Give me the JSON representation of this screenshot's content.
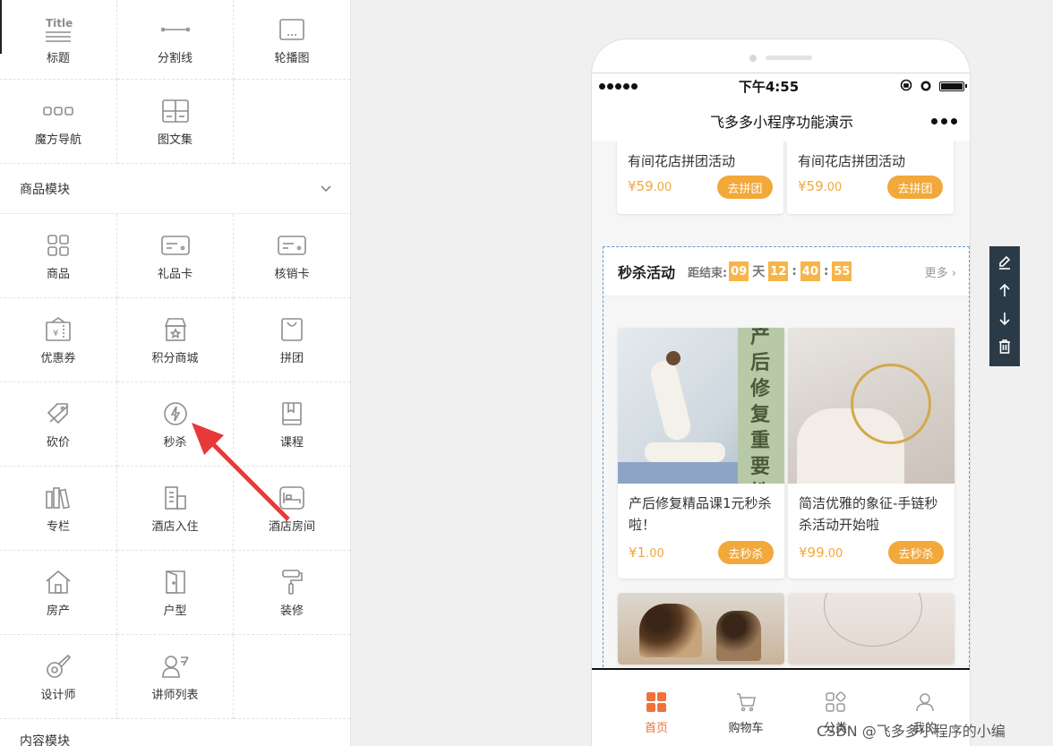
{
  "sidebar": {
    "top_items": [
      {
        "label": "标题",
        "icon": "title-icon",
        "icon_text": "Title"
      },
      {
        "label": "分割线",
        "icon": "divider-icon"
      },
      {
        "label": "轮播图",
        "icon": "carousel-icon"
      },
      {
        "label": "魔方导航",
        "icon": "cube-nav-icon"
      },
      {
        "label": "图文集",
        "icon": "gallery-icon"
      }
    ],
    "section_goods": {
      "title": "商品模块",
      "toggle_icon": "chevron-down-icon"
    },
    "goods_items": [
      {
        "label": "商品",
        "icon": "grid-icon"
      },
      {
        "label": "礼品卡",
        "icon": "gift-card-icon"
      },
      {
        "label": "核销卡",
        "icon": "verify-card-icon"
      },
      {
        "label": "优惠券",
        "icon": "coupon-icon"
      },
      {
        "label": "积分商城",
        "icon": "store-icon"
      },
      {
        "label": "拼团",
        "icon": "bag-icon"
      },
      {
        "label": "砍价",
        "icon": "bargain-tag-icon"
      },
      {
        "label": "秒杀",
        "icon": "lightning-icon"
      },
      {
        "label": "课程",
        "icon": "book-icon"
      },
      {
        "label": "专栏",
        "icon": "books-icon"
      },
      {
        "label": "酒店入住",
        "icon": "building-icon"
      },
      {
        "label": "酒店房间",
        "icon": "bed-icon"
      },
      {
        "label": "房产",
        "icon": "house-icon"
      },
      {
        "label": "户型",
        "icon": "door-icon"
      },
      {
        "label": "装修",
        "icon": "paint-roller-icon"
      },
      {
        "label": "设计师",
        "icon": "designer-icon"
      },
      {
        "label": "讲师列表",
        "icon": "lecturer-icon"
      }
    ],
    "section_next": {
      "title": "内容模块"
    }
  },
  "phone": {
    "status": {
      "time": "下午4:55"
    },
    "navbar": {
      "title": "飞多多小程序功能演示"
    },
    "group_cards": [
      {
        "title": "有间花店拼团活动",
        "price_symbol": "¥",
        "price_int": "59",
        "price_dec": ".00",
        "button": "去拼团"
      },
      {
        "title": "有间花店拼团活动",
        "price_symbol": "¥",
        "price_int": "59",
        "price_dec": ".00",
        "button": "去拼团"
      }
    ],
    "flash_sale": {
      "title": "秒杀活动",
      "countdown_label": "距结束:",
      "days": "09",
      "day_unit": "天",
      "hours": "12",
      "minutes": "40",
      "seconds": "55",
      "colon": ":",
      "more": "更多",
      "items": [
        {
          "title": "产后修复精品课1元秒杀啦！",
          "price_symbol": "¥",
          "price_int": "1",
          "price_dec": ".00",
          "button": "去秒杀",
          "image_text": "产后修复重要性"
        },
        {
          "title": "简洁优雅的象征-手链秒杀活动开始啦",
          "price_symbol": "¥",
          "price_int": "99",
          "price_dec": ".00",
          "button": "去秒杀"
        }
      ]
    },
    "tabbar": [
      {
        "label": "首页",
        "icon": "home-grid-icon",
        "active": true
      },
      {
        "label": "购物车",
        "icon": "cart-icon"
      },
      {
        "label": "分类",
        "icon": "category-icon"
      },
      {
        "label": "我的",
        "icon": "user-icon"
      }
    ]
  },
  "toolbox": {
    "items": [
      "edit-icon",
      "arrow-up-icon",
      "arrow-down-icon",
      "trash-icon"
    ]
  },
  "watermark": "CSDN @飞多多小程序的小编",
  "colors": {
    "accent": "#f2a83a",
    "tab_active": "#f0723a",
    "toolbox_bg": "#2b3a47",
    "arrow": "#e8393a"
  }
}
